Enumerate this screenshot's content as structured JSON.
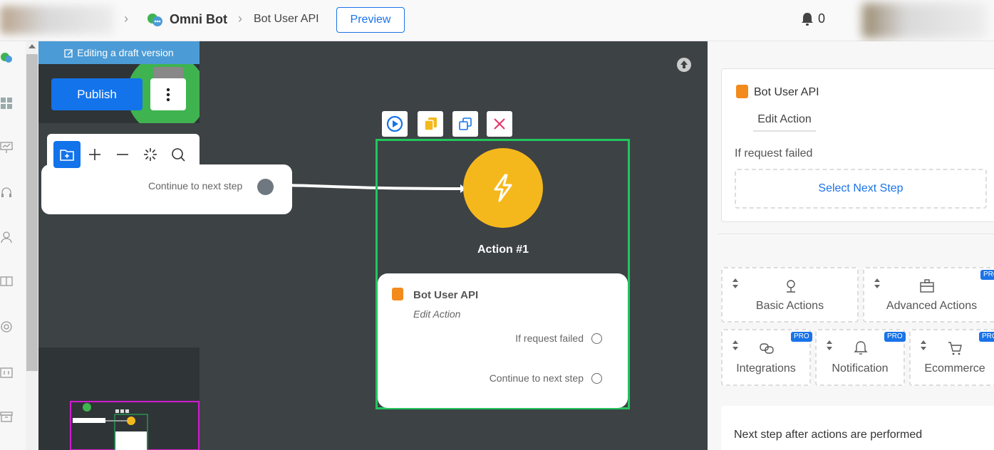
{
  "header": {
    "bot_name": "Omni Bot",
    "crumb": "Bot User API",
    "preview_label": "Preview",
    "notification_count": "0"
  },
  "canvas": {
    "draft_banner": "Editing a draft version",
    "publish_label": "Publish",
    "start_node_label": "Continue to next step",
    "action": {
      "title": "Action #1",
      "name": "Bot User API",
      "subtitle": "Edit Action",
      "row_failed": "If request failed",
      "row_continue": "Continue to next step"
    },
    "colors": {
      "canvas_bg": "#3d4245",
      "action_circle": "#f5b81c",
      "selection_border": "#22c55e",
      "publish_bg": "#1273eb"
    }
  },
  "right_panel": {
    "action_name": "Bot User API",
    "edit_tab": "Edit Action",
    "if_failed_label": "If request failed",
    "select_next_step": "Select Next Step",
    "tiles": [
      {
        "label": "Basic Actions",
        "icon": "map-pin-icon",
        "pro": ""
      },
      {
        "label": "Advanced Actions",
        "icon": "briefcase-icon",
        "pro": "PRO"
      },
      {
        "label": "Integrations",
        "icon": "link-icon",
        "pro": "PRO"
      },
      {
        "label": "Notification",
        "icon": "bell-icon",
        "pro": "PRO"
      },
      {
        "label": "Ecommerce",
        "icon": "cart-icon",
        "pro": "PRO"
      }
    ],
    "next_step_label": "Next step after actions are performed"
  }
}
